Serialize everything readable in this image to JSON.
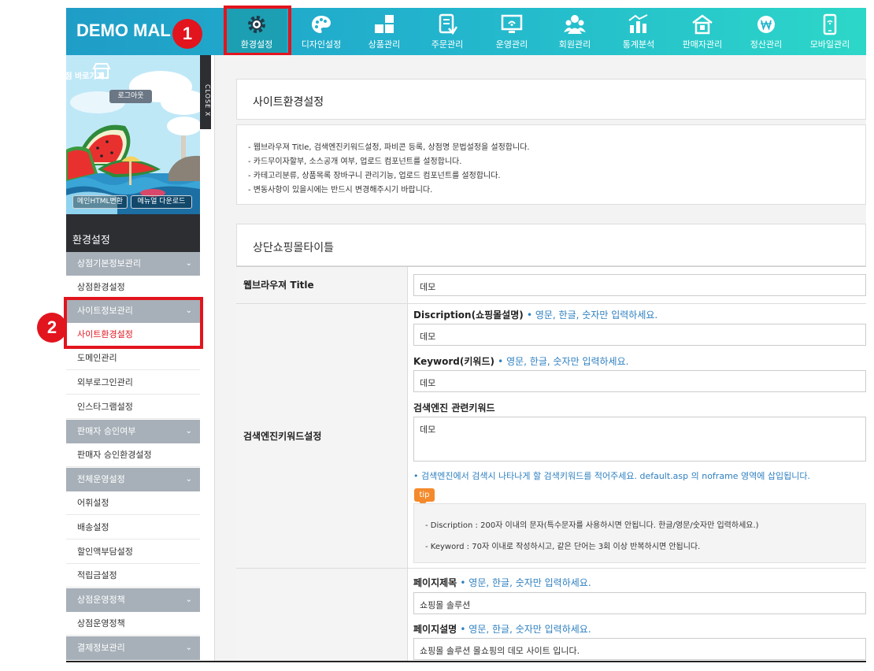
{
  "header": {
    "brand": "DEMO MAL",
    "nav": [
      {
        "label": "환경설정",
        "icon": "gear-icon"
      },
      {
        "label": "디자인설정",
        "icon": "palette-icon"
      },
      {
        "label": "상품관리",
        "icon": "boxes-icon"
      },
      {
        "label": "주문관리",
        "icon": "order-document-icon"
      },
      {
        "label": "운영관리",
        "icon": "monitor-icon"
      },
      {
        "label": "회원관리",
        "icon": "members-icon"
      },
      {
        "label": "통계분석",
        "icon": "statistics-icon"
      },
      {
        "label": "판매자관리",
        "icon": "store-building-icon"
      },
      {
        "label": "정산관리",
        "icon": "won-coin-icon"
      },
      {
        "label": "모바일관리",
        "icon": "mobile-icon"
      }
    ]
  },
  "annotations": {
    "step1": "1",
    "step2": "2"
  },
  "sidebar": {
    "store_link": "내상점 바로가기",
    "logout": "로그아웃",
    "close": "CLOSE X",
    "btn_html": "메인HTML변환",
    "btn_manual": "메뉴얼 다운로드",
    "section_title": "환경설정",
    "items": [
      {
        "label": "상점기본정보관리",
        "type": "cat"
      },
      {
        "label": "상점환경설정",
        "type": "sub"
      },
      {
        "label": "사이트정보관리",
        "type": "cat"
      },
      {
        "label": "사이트환경설정",
        "type": "sub",
        "active": true
      },
      {
        "label": "도메인관리",
        "type": "sub"
      },
      {
        "label": "외부로그인관리",
        "type": "sub"
      },
      {
        "label": "인스타그램설정",
        "type": "sub"
      },
      {
        "label": "판매자 승인여부",
        "type": "cat"
      },
      {
        "label": "판매자 승인환경설정",
        "type": "sub"
      },
      {
        "label": "전체운영설정",
        "type": "cat"
      },
      {
        "label": "어휘설정",
        "type": "sub"
      },
      {
        "label": "배송설정",
        "type": "sub"
      },
      {
        "label": "할인액부담설정",
        "type": "sub"
      },
      {
        "label": "적립금설정",
        "type": "sub"
      },
      {
        "label": "상점운영정책",
        "type": "cat"
      },
      {
        "label": "상점운영정책",
        "type": "sub"
      },
      {
        "label": "결제정보관리",
        "type": "cat"
      }
    ]
  },
  "main": {
    "page_title": "사이트환경설정",
    "desc": [
      "- 웹브라우져 Title, 검색엔진키워드설정, 파비콘 등록, 상점명 문법설정을 설정합니다.",
      "- 카드무이자할부, 소스공개 여부, 업로드 컴포넌트를 설정합니다.",
      "- 카테고리분류, 상품목록 장바구니 관리기능, 업로드 컴포넌트를 설정합니다.",
      "- 변동사항이 있을시에는 반드시 변경해주시기 바랍니다."
    ],
    "section_title": "상단쇼핑몰타이틀",
    "form": {
      "browser_title_label": "웹브라우져 Title",
      "browser_title_value": "데모",
      "seo_label": "검색엔진키워드설정",
      "description_label": "Discription(쇼핑몰설명)",
      "description_hint": "• 영문, 한글, 숫자만 입력하세요.",
      "description_value": "데모",
      "keyword_label": "Keyword(키워드)",
      "keyword_hint": "• 영문, 한글, 숫자만 입력하세요.",
      "keyword_value": "데모",
      "related_label": "검색엔진 관련키워드",
      "related_value": "데모",
      "related_hint": "• 검색엔진에서 검색시 나타나게 할 검색키워드를 적어주세요. default.asp 의 noframe 영역에 삽입됩니다.",
      "tip_badge": "tip",
      "tip_lines": [
        "- Discription : 200자 이내의 문자(특수문자를 사용하시면 안됩니다. 한글/영문/숫자만 입력하세요.)",
        "- Keyword : 70자 이내로 작성하시고, 같은 단어는 3회 이상 반복하시면 안됩니다."
      ],
      "page_title_label": "페이지제목",
      "page_title_hint": "• 영문, 한글, 숫자만 입력하세요.",
      "page_title_value": "쇼핑몰 솔루션",
      "page_desc_label": "페이지설명",
      "page_desc_hint": "• 영문, 한글, 숫자만 입력하세요.",
      "page_desc_value": "쇼핑몰 솔루션 몰쇼핑의 데모 사이트 입니다."
    }
  },
  "colors": {
    "accent_red": "#e2141e",
    "nav_start": "#1f9dc7",
    "nav_end": "#2cd7c8",
    "hint_blue": "#2d7fc0",
    "tip_orange": "#f48a2c"
  }
}
